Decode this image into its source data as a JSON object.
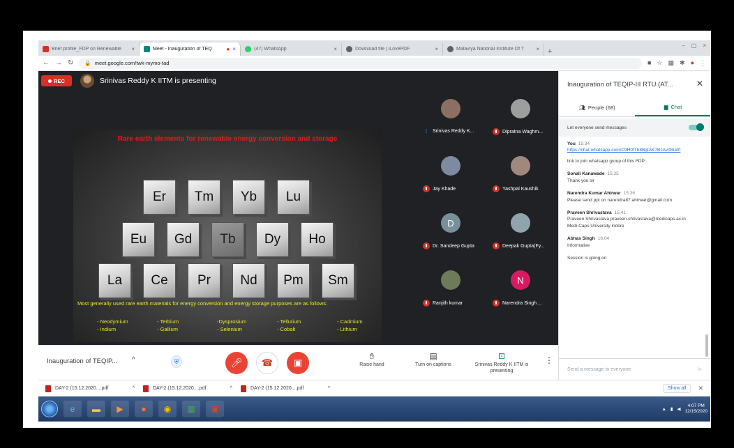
{
  "browser": {
    "tabs": [
      {
        "label": "Brief profile_FDP on Renewable",
        "icon_color": "#d93025",
        "active": false
      },
      {
        "label": "Meet - Inauguration of TEQ",
        "icon_color": "#00897b",
        "active": true
      },
      {
        "label": "(47) WhatsApp",
        "icon_color": "#25d366",
        "active": false
      },
      {
        "label": "Download file | iLovePDF",
        "icon_color": "#5f6368",
        "active": false
      },
      {
        "label": "Malaviya National Institute Of T",
        "icon_color": "#5f6368",
        "active": false
      }
    ],
    "url": "meet.google.com/twk-mymo-tad"
  },
  "meet": {
    "rec_label": "REC",
    "presenting_text": "Srinivas Reddy K IITM is presenting",
    "meeting_name": "Inauguration of TEQIP...",
    "actions": {
      "raise_hand": "Raise hand",
      "captions": "Turn on captions",
      "presenting": "Srinivas Reddy K IITM is presenting"
    }
  },
  "slide": {
    "title": "Rare earth elements for renewable energy conversion and storage",
    "elements_row1": [
      "Er",
      "Tm",
      "Yb",
      "Lu"
    ],
    "elements_row2": [
      "Eu",
      "Gd",
      "Tb",
      "Dy",
      "Ho"
    ],
    "elements_row3": [
      "La",
      "Ce",
      "Pr",
      "Nd",
      "Pm",
      "Sm"
    ],
    "text": "Most generally used rare earth materials for energy conversion and energy storage purposes are as follows:",
    "uses": [
      "- Neodymium",
      "- Terbium",
      "-Dysprosium",
      "- Tellurium",
      "- Cadmium",
      "- Indium",
      "- Gallium",
      "- Selenium",
      "- Cobalt",
      "- Lithium"
    ]
  },
  "participants": [
    {
      "name": "Srinivas Reddy K...",
      "initial": "",
      "avatar_color": "#8d6e63",
      "speaking": true
    },
    {
      "name": "Dipratna Waghm...",
      "initial": "",
      "avatar_color": "#9e9e9e",
      "speaking": false
    },
    {
      "name": "Jay Khade",
      "initial": "",
      "avatar_color": "#7d8aa0",
      "speaking": false
    },
    {
      "name": "Yashpal Kaushik",
      "initial": "",
      "avatar_color": "#a1887f",
      "speaking": false
    },
    {
      "name": "Dr. Sandeep Gupta",
      "initial": "D",
      "avatar_color": "#78909c",
      "speaking": false
    },
    {
      "name": "Deepak Gupta(Fy...",
      "initial": "",
      "avatar_color": "#90a4ae",
      "speaking": false
    },
    {
      "name": "Ranjith kumar",
      "initial": "",
      "avatar_color": "#6d7b5a",
      "speaking": false
    },
    {
      "name": "Narendra Singh ...",
      "initial": "N",
      "avatar_color": "#d81b60",
      "speaking": false
    }
  ],
  "panel": {
    "title": "Inauguration of TEQIP-III RTU (AT...",
    "people_tab": "People (68)",
    "chat_tab": "Chat",
    "setting": "Let everyone send messages",
    "messages": [
      {
        "sender": "You",
        "time": "15:34",
        "link": "https://chat.whatsapp.com/C9H0fTb8BgtAK7BJAv08LWt",
        "text": "link to join whatsapp group of this FDP"
      },
      {
        "sender": "Sonali Kanawade",
        "time": "15:35",
        "link": "",
        "text": "Thank you sir"
      },
      {
        "sender": "Narendra Kumar Ahirwar",
        "time": "15:36",
        "link": "",
        "text": "Please send ppt on narendra87.ahirwar@gmail.com"
      },
      {
        "sender": "Praveen Shrivastava",
        "time": "15:41",
        "link": "",
        "text": "Praveen Shrivastava praveen.shrivastava@medicaps.ac.in Medi-Caps University indore"
      },
      {
        "sender": "Abhas Singh",
        "time": "16:04",
        "link": "",
        "text": "Informative"
      },
      {
        "sender": "",
        "time": "",
        "link": "",
        "text": "Session is going on"
      }
    ],
    "composer_placeholder": "Send a message to everyone"
  },
  "downloads": {
    "items": [
      "DAY-2 (15.12.2020....pdf",
      "DAY-2 (15.12.2020....pdf",
      "DAY-2 (15.12.2020....pdf"
    ],
    "show_all": "Show all"
  },
  "taskbar": {
    "time": "4:07 PM",
    "date": "12/15/2020"
  }
}
